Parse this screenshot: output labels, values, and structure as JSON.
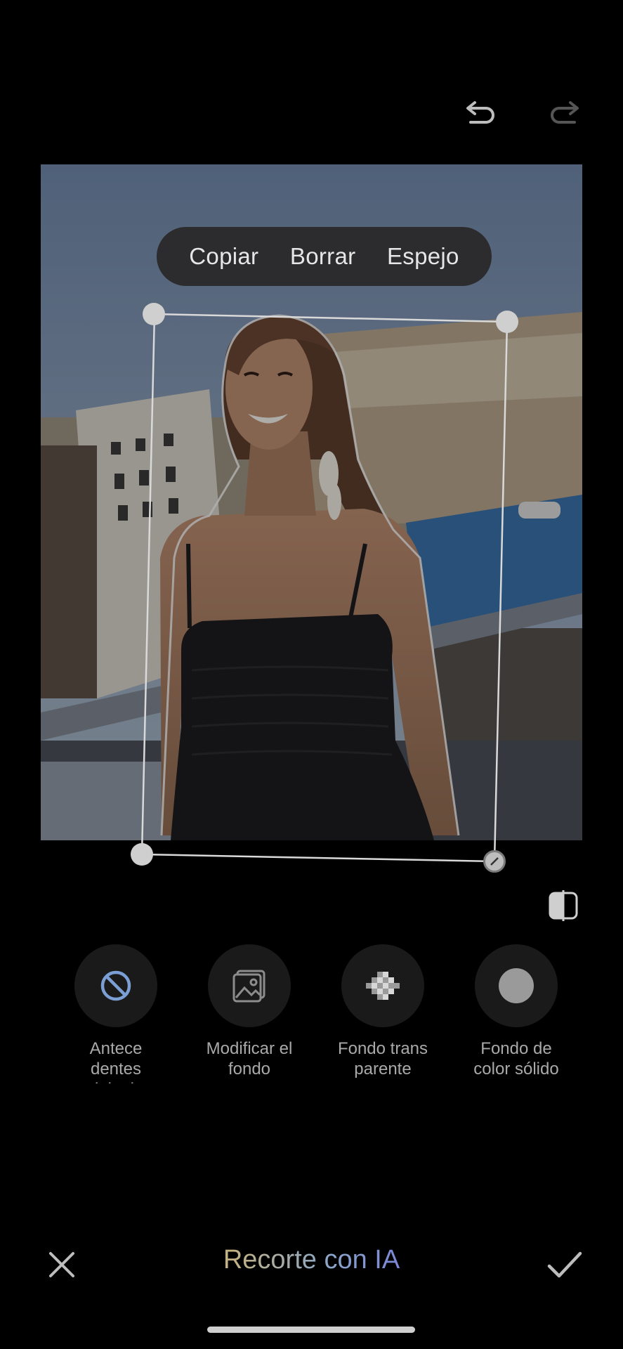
{
  "toolbar": {
    "undo_icon": "undo-icon",
    "redo_icon": "redo-icon"
  },
  "context_menu": {
    "copy_label": "Copiar",
    "delete_label": "Borrar",
    "mirror_label": "Espejo"
  },
  "options": [
    {
      "label": "Antece dentes originales",
      "icon": "no-background-icon"
    },
    {
      "label": "Modificar el fondo",
      "icon": "image-icon"
    },
    {
      "label": "Fondo trans parente",
      "icon": "checkerboard-icon"
    },
    {
      "label": "Fondo de color sólido",
      "icon": "solid-circle-icon"
    }
  ],
  "bottom_bar": {
    "title": "Recorte con IA",
    "cancel_icon": "close-icon",
    "confirm_icon": "check-icon"
  },
  "colors": {
    "accent_blue": "#7b9fd4",
    "title_gradient_start": "#c8b27c",
    "title_gradient_end": "#7b86d6"
  }
}
